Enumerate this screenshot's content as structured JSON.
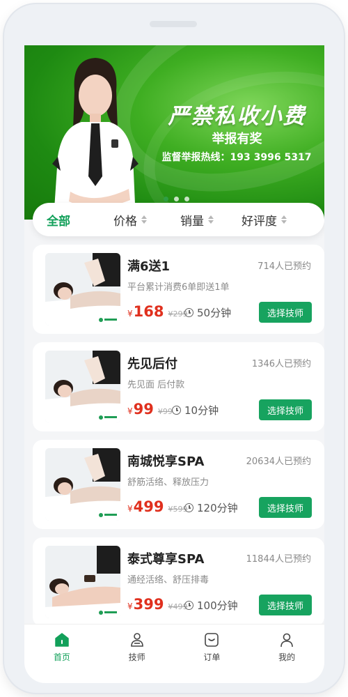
{
  "banner": {
    "title": "严禁私收小费",
    "subtitle": "举报有奖",
    "hotline": "监督举报热线：193 3996 5317"
  },
  "filters": [
    {
      "label": "全部"
    },
    {
      "label": "价格"
    },
    {
      "label": "销量"
    },
    {
      "label": "好评度"
    }
  ],
  "services": [
    {
      "title": "满6送1",
      "booked": "714人已预约",
      "desc": "平台累计消费6单即送1单",
      "currency": "¥",
      "price": "168",
      "original": "¥299",
      "duration": "50分钟",
      "button": "选择技师"
    },
    {
      "title": "先见后付",
      "booked": "1346人已预约",
      "desc": "先见面 后付款",
      "currency": "¥",
      "price": "99",
      "original": "¥99",
      "duration": "10分钟",
      "button": "选择技师"
    },
    {
      "title": "南城悦享SPA",
      "booked": "20634人已预约",
      "desc": "舒筋活络、释放压力",
      "currency": "¥",
      "price": "499",
      "original": "¥599",
      "duration": "120分钟",
      "button": "选择技师"
    },
    {
      "title": "泰式尊享SPA",
      "booked": "11844人已预约",
      "desc": "通经活络、舒压排毒",
      "currency": "¥",
      "price": "399",
      "original": "¥499",
      "duration": "100分钟",
      "button": "选择技师"
    }
  ],
  "tabs": [
    {
      "label": "首页",
      "icon": "home-icon"
    },
    {
      "label": "技师",
      "icon": "technician-icon"
    },
    {
      "label": "订单",
      "icon": "order-icon"
    },
    {
      "label": "我的",
      "icon": "profile-icon"
    }
  ],
  "colors": {
    "accent": "#17a35f",
    "price": "#e0301e",
    "banner_green": "#2fa31c"
  }
}
